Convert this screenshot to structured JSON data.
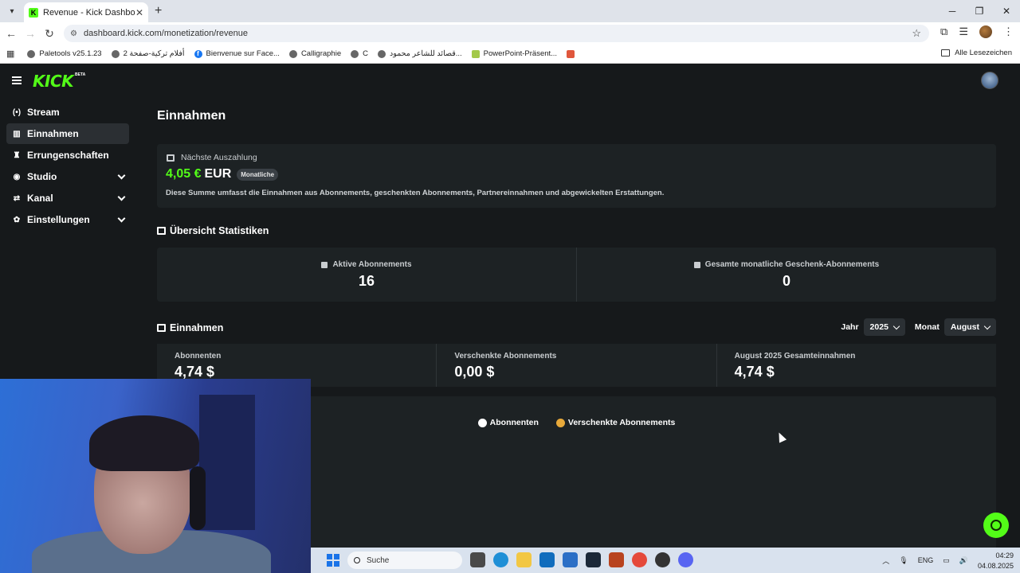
{
  "browser": {
    "tab_title": "Revenue - Kick Dashboard",
    "url": "dashboard.kick.com/monetization/revenue",
    "bookmarks": [
      {
        "label": "Paletools v25.1.23",
        "icon": "globe-icon"
      },
      {
        "label": "أفلام تركية-صفحة 2",
        "icon": "globe-icon"
      },
      {
        "label": "Bienvenue sur Face...",
        "icon": "facebook-icon"
      },
      {
        "label": "Calligraphie",
        "icon": "globe-icon"
      },
      {
        "label": "C",
        "icon": "globe-icon"
      },
      {
        "label": "قصائد للشاعر محمود...",
        "icon": "globe-icon"
      },
      {
        "label": "PowerPoint-Präsent...",
        "icon": "powerpoint-icon"
      }
    ],
    "all_bookmarks_label": "Alle Lesezeichen"
  },
  "app": {
    "logo": "KICK",
    "logo_badge": "BETA",
    "sidebar": {
      "items": [
        {
          "label": "Stream",
          "icon": "broadcast-icon",
          "active": false,
          "expandable": false
        },
        {
          "label": "Einnahmen",
          "icon": "chart-icon",
          "active": true,
          "expandable": false
        },
        {
          "label": "Errungenschaften",
          "icon": "trophy-icon",
          "active": false,
          "expandable": false
        },
        {
          "label": "Studio",
          "icon": "studio-icon",
          "active": false,
          "expandable": true
        },
        {
          "label": "Kanal",
          "icon": "channel-icon",
          "active": false,
          "expandable": true
        },
        {
          "label": "Einstellungen",
          "icon": "gear-icon",
          "active": false,
          "expandable": true
        }
      ]
    },
    "page_title": "Einnahmen",
    "payout": {
      "heading": "Nächste Auszahlung",
      "amount": "4,05 €",
      "currency": "EUR",
      "badge": "Monatliche",
      "description": "Diese Summe umfasst die Einnahmen aus Abonnements, geschenkten Abonnements, Partnereinnahmen und abgewickelten Erstattungen."
    },
    "overview": {
      "title": "Übersicht Statistiken",
      "stats": [
        {
          "label": "Aktive Abonnements",
          "value": "16"
        },
        {
          "label": "Gesamte monatliche Geschenk-Abonnements",
          "value": "0"
        }
      ]
    },
    "revenue": {
      "title": "Einnahmen",
      "year_label": "Jahr",
      "year_value": "2025",
      "month_label": "Monat",
      "month_value": "August",
      "cards": [
        {
          "label": "Abonnenten",
          "value": "4,74 $"
        },
        {
          "label": "Verschenkte Abonnements",
          "value": "0,00 $"
        },
        {
          "label": "August 2025 Gesamteinnahmen",
          "value": "4,74 $"
        }
      ],
      "legend": [
        {
          "label": "Abonnenten",
          "color": "#ffffff"
        },
        {
          "label": "Verschenkte Abonnements",
          "color": "#e8a93a"
        }
      ]
    },
    "colors": {
      "accent": "#53fc18",
      "background": "#16191b",
      "card": "#1d2224"
    }
  },
  "taskbar": {
    "search_placeholder": "Suche",
    "language": "ENG",
    "time": "04:29",
    "date": "04.08.2025"
  }
}
